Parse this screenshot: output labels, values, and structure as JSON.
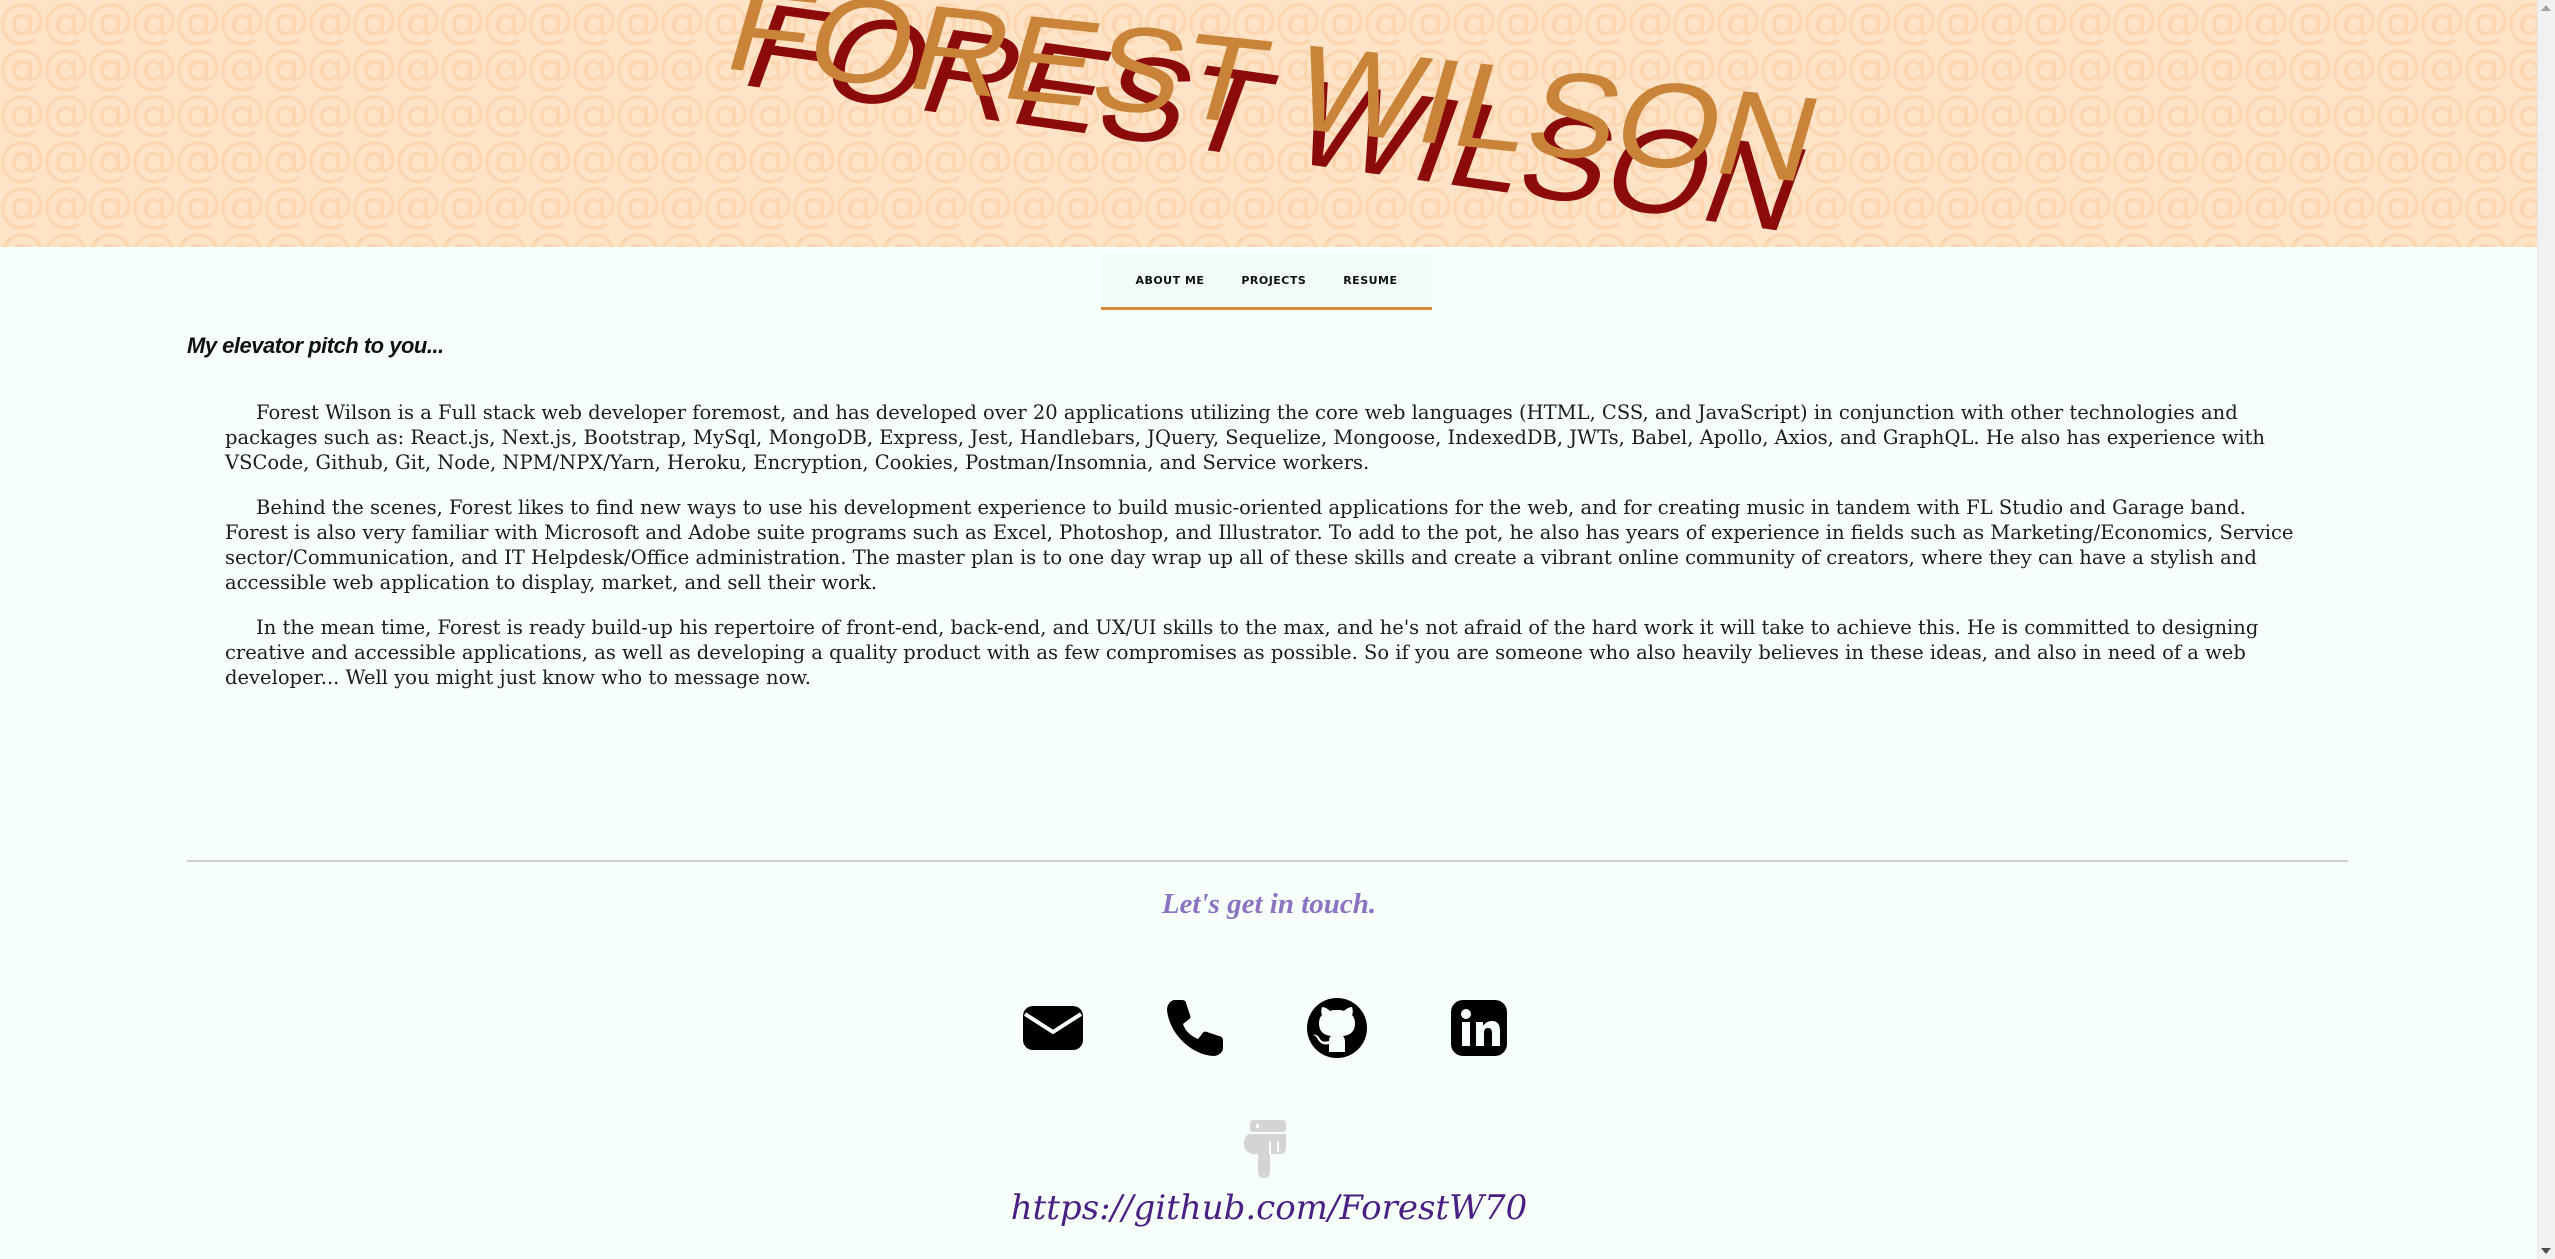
{
  "header": {
    "title": "FOREST WILSON",
    "colors": {
      "banner": "#ffe3c6",
      "front": "#c98439",
      "shadow": "#8b0a0a",
      "pattern": "#fbd9b8"
    }
  },
  "nav": {
    "items": [
      {
        "label": "ABOUT ME"
      },
      {
        "label": "PROJECTS"
      },
      {
        "label": "RESUME"
      }
    ],
    "accent": "#d6893a"
  },
  "main": {
    "pitch_title": "My elevator pitch to you...",
    "paragraphs": [
      "Forest Wilson is a Full stack web developer foremost, and has developed over 20 applications utilizing the core web languages (HTML, CSS, and JavaScript) in conjunction with other technologies and packages such as: React.js, Next.js, Bootstrap, MySql, MongoDB, Express, Jest, Handlebars, JQuery, Sequelize, Mongoose, IndexedDB, JWTs, Babel, Apollo, Axios, and GraphQL. He also has experience with VSCode, Github, Git, Node, NPM/NPX/Yarn, Heroku, Encryption, Cookies, Postman/Insomnia, and Service workers.",
      "Behind the scenes, Forest likes to find new ways to use his development experience to build music-oriented applications for the web, and for creating music in tandem with FL Studio and Garage band. Forest is also very familiar with Microsoft and Adobe suite programs such as Excel, Photoshop, and Illustrator. To add to the pot, he also has years of experience in fields such as Marketing/Economics, Service sector/Communication, and IT Helpdesk/Office administration. The master plan is to one day wrap up all of these skills and create a vibrant online community of creators, where they can have a stylish and accessible web application to display, market, and sell their work.",
      "In the mean time, Forest is ready build-up his repertoire of front-end, back-end, and UX/UI skills to the max, and he's not afraid of the hard work it will take to achieve this. He is committed to designing creative and accessible applications, as well as developing a quality product with as few compromises as possible. So if you are someone who also heavily believes in these ideas, and also in need of a web developer... Well you might just know who to message now."
    ]
  },
  "contact": {
    "heading": "Let's get in touch.",
    "heading_color": "#8b73c2",
    "icons": [
      "envelope-icon",
      "phone-icon",
      "github-icon",
      "linkedin-icon"
    ],
    "pointer_icon": "hand-pointing-down-icon",
    "link_text": "https://github.com/ForestW70",
    "link_color": "#4a1f84"
  }
}
